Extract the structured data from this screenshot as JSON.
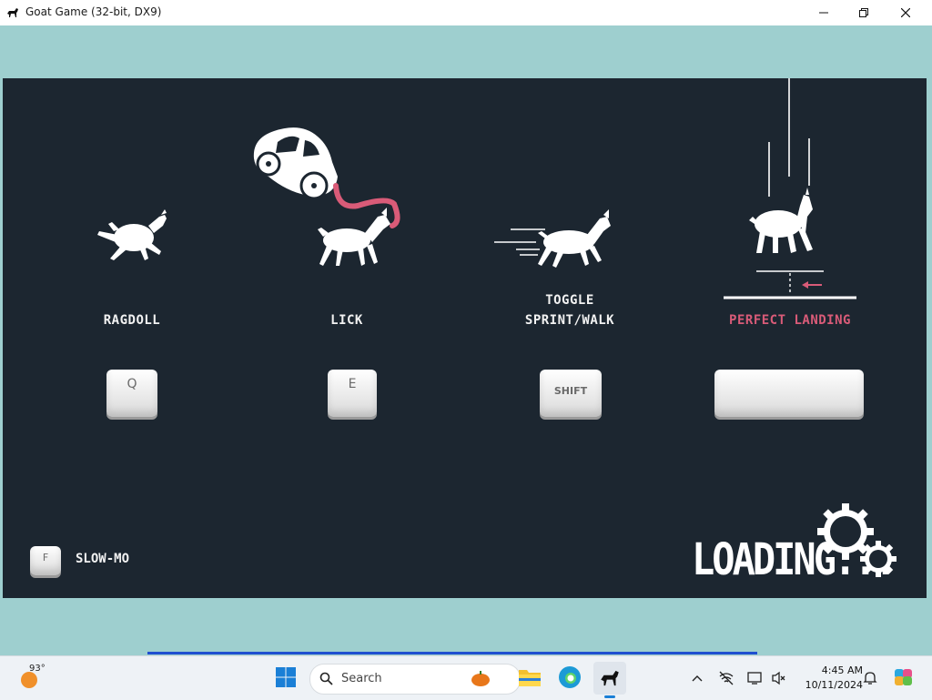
{
  "window": {
    "title": "Goat Game (32-bit, DX9)",
    "minimize_icon": "minimize-icon",
    "restore_icon": "restore-icon",
    "close_icon": "close-icon"
  },
  "controls": [
    {
      "label": "RAGDOLL",
      "key": "Q",
      "icon": "ragdoll-goat-icon"
    },
    {
      "label": "LICK",
      "key": "E",
      "icon": "lick-goat-car-icon"
    },
    {
      "label": "TOGGLE\nSPRINT/WALK",
      "key": "SHIFT",
      "icon": "sprint-goat-icon"
    },
    {
      "label": "PERFECT LANDING",
      "key": "",
      "icon": "landing-goat-icon"
    }
  ],
  "slowmo": {
    "key": "F",
    "label": "SLOW-MO"
  },
  "loading": {
    "text": "LOADING...",
    "icon": "gears-icon"
  },
  "colors": {
    "game_bg": "#1c2630",
    "teal": "#9ecfcf",
    "pink": "#d95b78",
    "white": "#ffffff"
  },
  "taskbar": {
    "weather": {
      "temp": "93°",
      "icon": "weather-sun-icon"
    },
    "search": {
      "placeholder": "Search",
      "icon": "search-icon"
    },
    "apps": [
      "windows-start-icon",
      "file-explorer-icon",
      "edge-browser-icon",
      "goat-game-icon"
    ],
    "tray": [
      "chevron-up-icon",
      "network-icon",
      "display-icon",
      "volume-muted-icon",
      "notification-bell-icon",
      "copilot-icon"
    ],
    "clock": {
      "time": "4:45 AM",
      "date": "10/11/2024"
    }
  }
}
